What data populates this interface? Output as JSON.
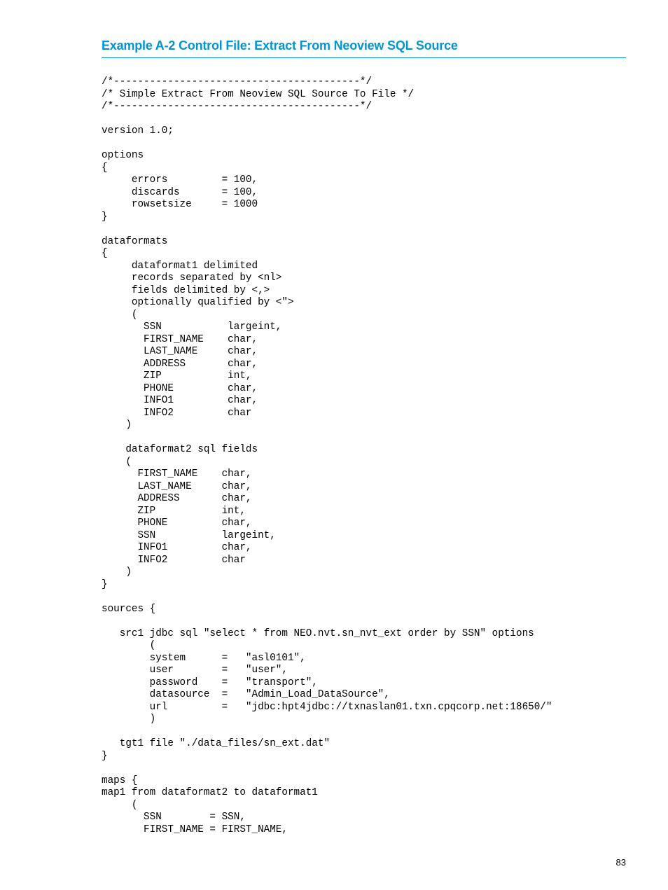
{
  "heading": "Example A-2 Control File: Extract From Neoview SQL Source",
  "code": "/*-----------------------------------------*/\n/* Simple Extract From Neoview SQL Source To File */\n/*-----------------------------------------*/\n\nversion 1.0;\n\noptions\n{\n     errors         = 100,\n     discards       = 100,\n     rowsetsize     = 1000\n}\n\ndataformats\n{\n     dataformat1 delimited\n     records separated by <nl>\n     fields delimited by <,>\n     optionally qualified by <\">\n     (\n       SSN           largeint,\n       FIRST_NAME    char,\n       LAST_NAME     char,\n       ADDRESS       char,\n       ZIP           int,\n       PHONE         char,\n       INFO1         char,\n       INFO2         char\n    )\n\n    dataformat2 sql fields\n    (\n      FIRST_NAME    char,\n      LAST_NAME     char,\n      ADDRESS       char,\n      ZIP           int,\n      PHONE         char,\n      SSN           largeint,\n      INFO1         char,\n      INFO2         char\n    )\n}\n\nsources {\n\n   src1 jdbc sql \"select * from NEO.nvt.sn_nvt_ext order by SSN\" options\n        (\n        system      =   \"asl0101\",\n        user        =   \"user\",\n        password    =   \"transport\",\n        datasource  =   \"Admin_Load_DataSource\",\n        url         =   \"jdbc:hpt4jdbc://txnaslan01.txn.cpqcorp.net:18650/\"\n        )\n\n   tgt1 file \"./data_files/sn_ext.dat\"\n}\n\nmaps {\nmap1 from dataformat2 to dataformat1\n     (\n       SSN        = SSN,\n       FIRST_NAME = FIRST_NAME,",
  "page_number": "83"
}
